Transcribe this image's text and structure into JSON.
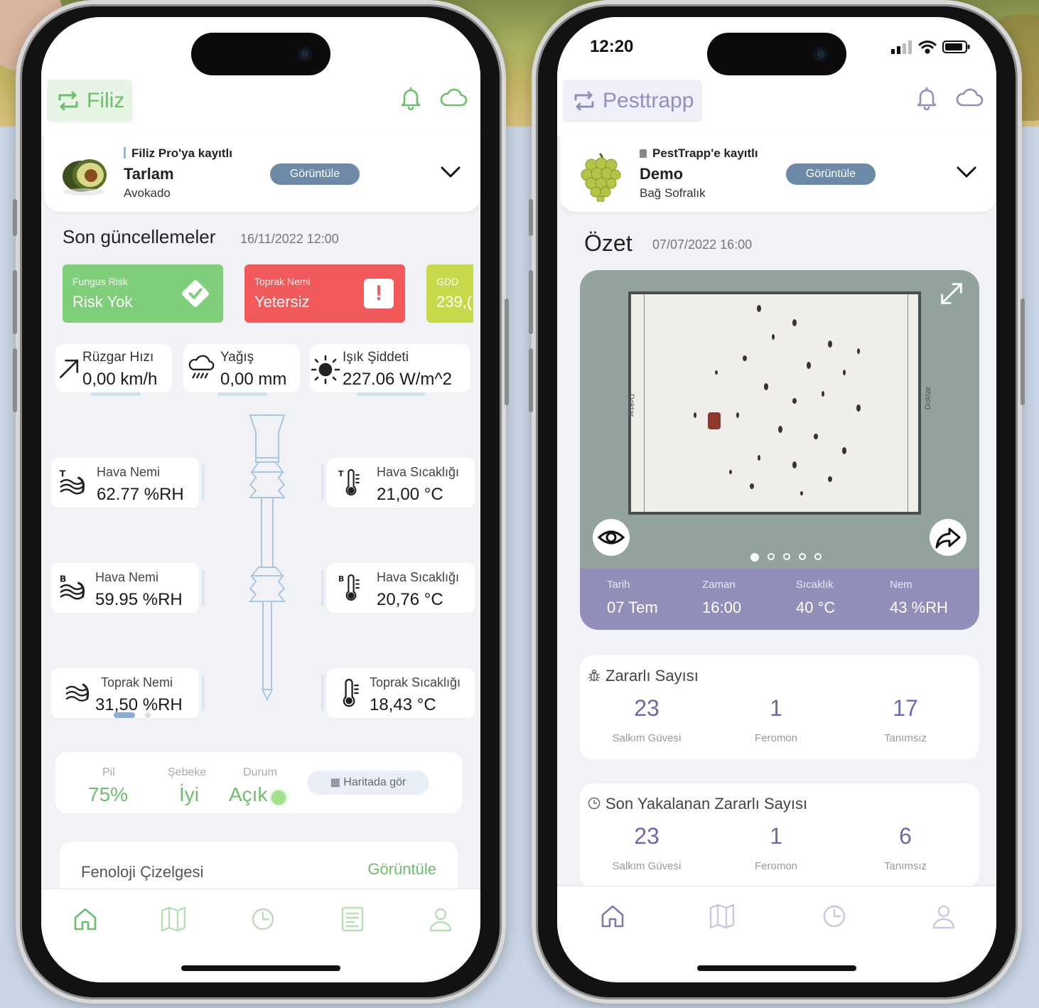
{
  "colors": {
    "filiz_green": "#6cbe6a",
    "pesttrapp_purple": "#8f8fba",
    "view_button_blue": "#6c89a8",
    "risk_ok": "#7fcf7a",
    "risk_bad": "#f05a5a",
    "gdd": "#c7d84a"
  },
  "left": {
    "brand": "Filiz",
    "farm": {
      "registration": "Filiz Pro'ya kayıtlı",
      "name": "Tarlam",
      "crop": "Avokado",
      "view_label": "Görüntüle"
    },
    "updates": {
      "title": "Son güncellemeler",
      "date": "16/11/2022 12:00"
    },
    "tiles": [
      {
        "label": "Fungus Risk",
        "value": "Risk Yok"
      },
      {
        "label": "Toprak Nemi",
        "value": "Yetersiz",
        "icon_text": "!"
      },
      {
        "label": "GDD",
        "value": "239,("
      }
    ],
    "weather": [
      {
        "label": "Rüzgar Hızı",
        "value": "0,00 km/h",
        "icon": "arrow-up-right-icon"
      },
      {
        "label": "Yağış",
        "value": "0,00 mm",
        "icon": "rain-cloud-icon"
      },
      {
        "label": "Işık Şiddeti",
        "value": "227.06 W/m^2",
        "icon": "sun-icon"
      }
    ],
    "sensors": [
      {
        "label": "Hava Nemi",
        "value": "62.77 %RH",
        "icon": "humidity-top-icon",
        "tag": "T"
      },
      {
        "label": "Hava Sıcaklığı",
        "value": "21,00 °C",
        "icon": "thermometer-top-icon",
        "tag": "T"
      },
      {
        "label": "Hava Nemi",
        "value": "59.95 %RH",
        "icon": "humidity-bottom-icon",
        "tag": "B"
      },
      {
        "label": "Hava Sıcaklığı",
        "value": "20,76 °C",
        "icon": "thermometer-bottom-icon",
        "tag": "B"
      },
      {
        "label": "Toprak Nemi",
        "value": "31,50 %RH",
        "icon": "soil-humidity-icon"
      },
      {
        "label": "Toprak Sıcaklığı",
        "value": "18,43 °C",
        "icon": "soil-thermometer-icon"
      }
    ],
    "status": {
      "battery_label": "Pil",
      "battery": "75%",
      "network_label": "Şebeke",
      "network": "İyi",
      "state_label": "Durum",
      "state": "Açık",
      "map_button": "Haritada gör"
    },
    "phenology": {
      "title": "Fenoloji Çizelgesi",
      "view_label": "Görüntüle"
    }
  },
  "right": {
    "time": "12:20",
    "brand": "Pesttrapp",
    "farm": {
      "registration": "PestTrapp'e kayıtlı",
      "name": "Demo",
      "crop": "Bağ Sofralık",
      "view_label": "Görüntüle"
    },
    "summary": {
      "title": "Özet",
      "date": "07/07/2022 16:00"
    },
    "trap_labels": [
      "Doktar",
      "Doktar"
    ],
    "photo_meta": [
      {
        "label": "Tarih",
        "value": "07 Tem"
      },
      {
        "label": "Zaman",
        "value": "16:00"
      },
      {
        "label": "Sıcaklık",
        "value": "40 °C"
      },
      {
        "label": "Nem",
        "value": "43 %RH"
      }
    ],
    "carousel": {
      "count": 5,
      "active": 0
    },
    "pest_count": {
      "title": "Zararlı Sayısı",
      "items": [
        {
          "value": "23",
          "label": "Salkım Güvesi"
        },
        {
          "value": "1",
          "label": "Feromon"
        },
        {
          "value": "17",
          "label": "Tanımsız"
        }
      ]
    },
    "last_caught": {
      "title": "Son Yakalanan Zararlı Sayısı",
      "items": [
        {
          "value": "23",
          "label": "Salkım Güvesi"
        },
        {
          "value": "1",
          "label": "Feromon"
        },
        {
          "value": "6",
          "label": "Tanımsız"
        }
      ]
    }
  }
}
